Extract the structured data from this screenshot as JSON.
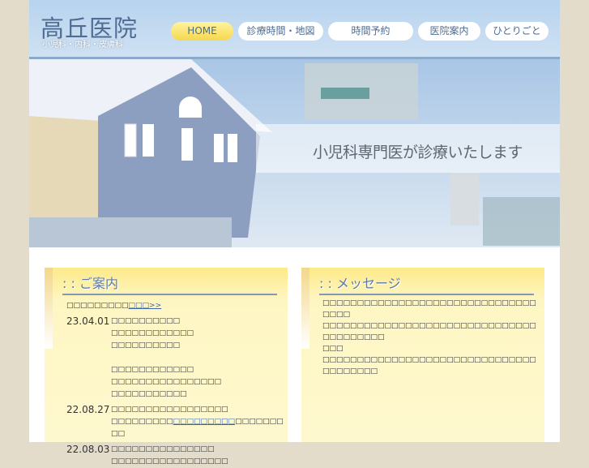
{
  "header": {
    "logo": "高丘医院",
    "subtitle": "小児科・内科・皮膚科"
  },
  "nav": [
    {
      "label": "HOME"
    },
    {
      "label": "診療時間・地図"
    },
    {
      "label": "時間予約"
    },
    {
      "label": "医院案内"
    },
    {
      "label": "ひとりごと"
    }
  ],
  "banner": {
    "tagline": "小児科専門医が診療いたします"
  },
  "info": {
    "title": ": : ご案内",
    "intro_text": "□□□□□□□□□",
    "intro_link": "□□□>>",
    "news": [
      {
        "date": "23.04.01",
        "lines": [
          "□□□□□□□□□□",
          "□□□□□□□□□□□□",
          "□□□□□□□□□□",
          "",
          "□□□□□□□□□□□□",
          "□□□□□□□□□□□□□□□□",
          "□□□□□□□□□□□"
        ]
      },
      {
        "date": "22.08.27",
        "line1": "□□□□□□□□□□□□□□□□□",
        "line2_pre": "□□□□□□□□□",
        "line2_link": "□□□□□□□□□",
        "line2_post": "□□□□□□□□□"
      },
      {
        "date": "22.08.03",
        "lines": [
          "□□□□□□□□□□□□□□□",
          "□□□□□□□□□□□□□□□□□"
        ]
      }
    ]
  },
  "message": {
    "title": ": : メッセージ",
    "lines": [
      "□□□□□□□□□□□□□□□□□□□□□□□□□□□□□□□□□□□",
      "□□□□□□□□□□□□□□□□□□□□□□□□□□□□□□□□□□□□□□□□",
      "□□□",
      "□□□□□□□□□□□□□□□□□□□□□□□□□□□□□□□□□□□□□□□"
    ]
  }
}
